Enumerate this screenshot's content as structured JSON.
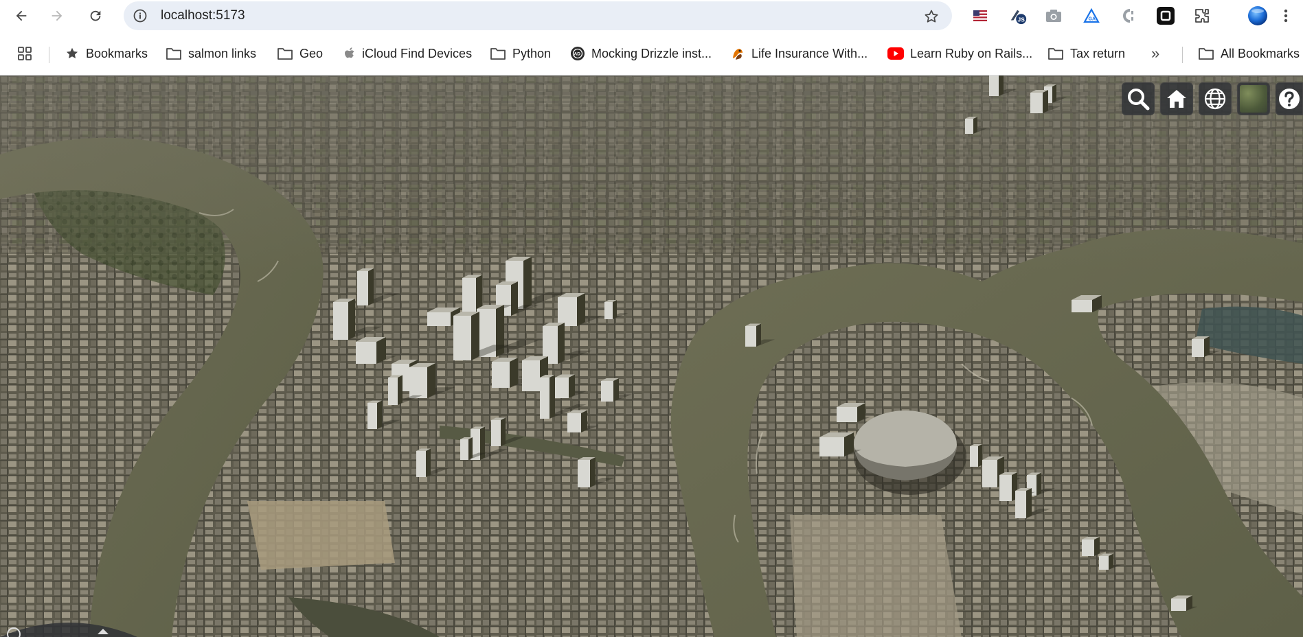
{
  "browser": {
    "url": "localhost:5173",
    "extensions": [
      "flag-extension-icon",
      "js-extension-icon",
      "camera-extension-icon",
      "triangle-extension-icon",
      "c-extension-icon",
      "square-extension-icon",
      "puzzle-icon",
      "profile-avatar",
      "more-menu-icon"
    ]
  },
  "bookmarks": {
    "items": [
      {
        "label": "Bookmarks",
        "icon": "star-icon"
      },
      {
        "label": "salmon links",
        "icon": "folder-icon"
      },
      {
        "label": "Geo",
        "icon": "folder-icon"
      },
      {
        "label": "iCloud Find Devices",
        "icon": "apple-icon"
      },
      {
        "label": "Python",
        "icon": "folder-icon"
      },
      {
        "label": "Mocking Drizzle inst...",
        "icon": "site-icon"
      },
      {
        "label": "Life Insurance With...",
        "icon": "site-icon"
      },
      {
        "label": "Learn Ruby on Rails...",
        "icon": "youtube-icon"
      },
      {
        "label": "Tax return",
        "icon": "folder-icon"
      }
    ],
    "overflow": "»",
    "all_bookmarks": "All Bookmarks"
  },
  "map": {
    "toolbar": [
      {
        "name": "search-button",
        "icon": "search-icon"
      },
      {
        "name": "home-button",
        "icon": "home-icon"
      },
      {
        "name": "scene-mode-button",
        "icon": "globe-icon"
      },
      {
        "name": "base-layer-picker",
        "icon": "imagery-thumbnail"
      },
      {
        "name": "help-button",
        "icon": "question-icon"
      }
    ],
    "colors": {
      "river": "#6a6a52",
      "urban": "#5d5a4c",
      "building_lit": "#d8d8d2",
      "building_shadow": "#3b3a2a",
      "dome": "#b5b3a8"
    }
  }
}
